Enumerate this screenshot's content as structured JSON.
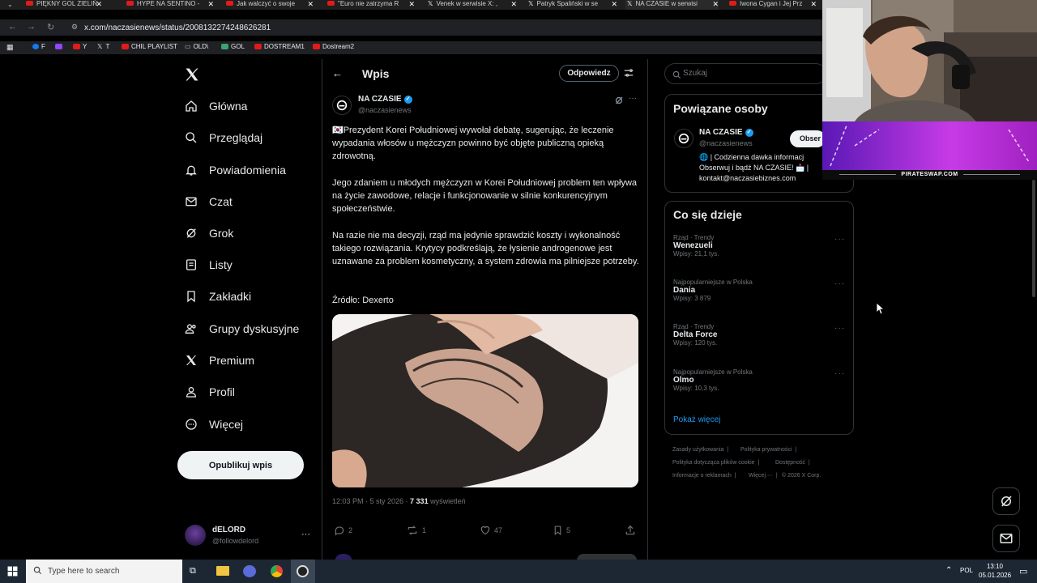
{
  "browser": {
    "tabs": [
      {
        "title": "PIĘKNY GOL ZIELIŃ",
        "icon": "youtube-icon"
      },
      {
        "title": "HYPE NA SENTINO -",
        "icon": "youtube-icon"
      },
      {
        "title": "Jak walczyć o swoje",
        "icon": "youtube-icon"
      },
      {
        "title": "\"Euro nie zatrzyma R",
        "icon": "youtube-icon"
      },
      {
        "title": "Venek w serwisie X: ,",
        "icon": "x-icon"
      },
      {
        "title": "Patryk Spaliński w se",
        "icon": "x-icon"
      },
      {
        "title": "NA CZASIE w serwisi",
        "icon": "x-icon"
      },
      {
        "title": "Iwona Cygan i Jej Prz",
        "icon": "youtube-icon"
      }
    ],
    "url": "x.com/naczasienews/status/2008132274248626281",
    "bookmarks": [
      "F",
      "Y",
      "T",
      "CHIL PLAYLIST",
      "OLD\\",
      "GOL",
      "DOSTREAM1",
      "Dostream2"
    ]
  },
  "nav": {
    "items": [
      {
        "label": "Główna",
        "icon": "home-icon"
      },
      {
        "label": "Przeglądaj",
        "icon": "search-icon"
      },
      {
        "label": "Powiadomienia",
        "icon": "bell-icon"
      },
      {
        "label": "Czat",
        "icon": "mail-icon"
      },
      {
        "label": "Grok",
        "icon": "grok-icon"
      },
      {
        "label": "Listy",
        "icon": "list-icon"
      },
      {
        "label": "Zakładki",
        "icon": "bookmark-icon"
      },
      {
        "label": "Grupy dyskusyjne",
        "icon": "people-icon"
      },
      {
        "label": "Premium",
        "icon": "x-logo-icon"
      },
      {
        "label": "Profil",
        "icon": "person-icon"
      },
      {
        "label": "Więcej",
        "icon": "more-circle-icon"
      }
    ],
    "post_button": "Opublikuj wpis",
    "account": {
      "name": "dELORD",
      "handle": "@followdelord"
    }
  },
  "post": {
    "header_title": "Wpis",
    "reply_button": "Odpowiedz",
    "author_name": "NA CZASIE",
    "author_handle": "@naczasienews",
    "p1": "🇰🇷Prezydent Korei Południowej wywołał debatę, sugerując, że leczenie wypadania włosów u mężczyzn powinno być objęte publiczną opieką zdrowotną.",
    "p2": "Jego zdaniem u młodych mężczyzn w Korei Południowej problem ten wpływa na życie zawodowe, relacje i funkcjonowanie w silnie konkurencyjnym społeczeństwie.",
    "p3": "Na razie nie ma decyzji, rząd ma jedynie sprawdzić koszty i wykonalność takiego rozwiązania. Krytycy podkreślają, że łysienie androgenowe jest uznawane za problem kosmetyczny, a system zdrowia ma pilniejsze potrzeby.",
    "p4": "Źródło: Dexerto",
    "meta_time": "12:03 PM · 5 sty 2026 · ",
    "meta_views": "7 331",
    "meta_views_label": " wyświetleń",
    "replies": "2",
    "reposts": "1",
    "likes": "47",
    "bookmarks": "5"
  },
  "sidebar": {
    "search_placeholder": "Szukaj",
    "related_title": "Powiązane osoby",
    "related": {
      "name": "NA CZASIE",
      "handle": "@naczasienews",
      "follow_button": "Obser",
      "bio1": "🌐 | Codzienna dawka informacj",
      "bio2": "Obserwuj i bądź NA CZASIE! 📩 |",
      "bio3": "kontakt@naczasiebiznes.com"
    },
    "trends_title": "Co się dzieje",
    "trends": [
      {
        "category": "Rząd · Trendy",
        "name": "Wenezueli",
        "count": "Wpisy: 21,1 tys."
      },
      {
        "category": "Najpopularniejsze w Polska",
        "name": "Dania",
        "count": "Wpisy: 3 879"
      },
      {
        "category": "Rząd · Trendy",
        "name": "Delta Force",
        "count": "Wpisy: 120 tys."
      },
      {
        "category": "Najpopularniejsze w Polska",
        "name": "Olmo",
        "count": "Wpisy: 10,3 tys."
      }
    ],
    "show_more": "Pokaż więcej",
    "footer": [
      "Zasady użytkowania",
      "Polityka prywatności",
      "Polityka dotycząca plików cookie",
      "Dostępność",
      "Informacje o reklamach",
      "Więcej ···",
      "© 2026 X Corp."
    ]
  },
  "overlay": {
    "banner_text": "PIRATESWAP.COM"
  },
  "taskbar": {
    "search_placeholder": "Type here to search",
    "lang": "POL",
    "time": "13:10",
    "date": "05.01.2026"
  },
  "colors": {
    "accent": "#1d9bf0",
    "background": "#000000",
    "border": "#2f3336",
    "muted": "#71767b"
  }
}
